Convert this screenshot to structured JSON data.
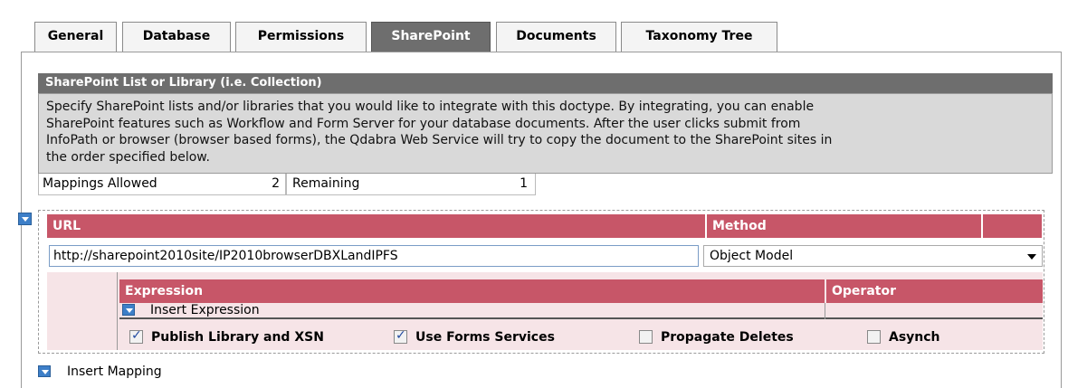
{
  "tabs": [
    {
      "label": "General",
      "active": false
    },
    {
      "label": "Database",
      "active": false
    },
    {
      "label": "Permissions",
      "active": false
    },
    {
      "label": "SharePoint",
      "active": true
    },
    {
      "label": "Documents",
      "active": false
    },
    {
      "label": "Taxonomy Tree",
      "active": false
    }
  ],
  "section": {
    "title": "SharePoint List or Library (i.e. Collection)",
    "description_lines": [
      "Specify SharePoint lists and/or libraries that you would like to integrate with this doctype. By integrating, you can enable",
      "SharePoint features such as Workflow and Form Server for your database documents. After the user clicks submit from",
      "InfoPath or browser (browser based forms), the Qdabra Web Service will try to copy the document to the SharePoint sites in",
      "the order specified below."
    ]
  },
  "allocation": {
    "allowed_label": "Mappings Allowed",
    "allowed_value": "2",
    "remaining_label": "Remaining",
    "remaining_value": "1"
  },
  "mapping": {
    "url_header": "URL",
    "method_header": "Method",
    "url_value": "http://sharepoint2010site/IP2010browserDBXLandIPFS",
    "method_value": "Object Model",
    "expression_header": "Expression",
    "operator_header": "Operator",
    "insert_expression_label": "Insert Expression",
    "options": [
      {
        "label": "Publish Library and XSN",
        "checked": true
      },
      {
        "label": "Use Forms Services",
        "checked": true
      },
      {
        "label": "Propagate Deletes",
        "checked": false
      },
      {
        "label": "Asynch",
        "checked": false
      }
    ]
  },
  "insert_mapping_label": "Insert Mapping",
  "colors": {
    "tab_active": "#6e6e6e",
    "header_red": "#c75668",
    "expand_blue": "#3d7fc8"
  }
}
